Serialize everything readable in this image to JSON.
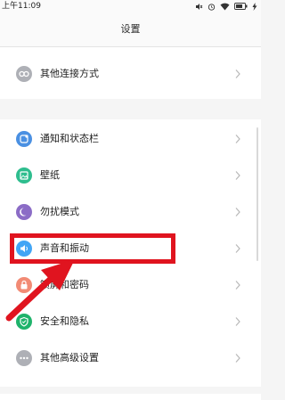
{
  "status_bar": {
    "time": "上午11:09",
    "icons": [
      "mute-icon",
      "alarm-icon",
      "wifi-icon",
      "battery-icon",
      "charging-icon"
    ]
  },
  "title_bar": {
    "title": "设置"
  },
  "settings": {
    "top_group": [
      {
        "label": "其他连接方式",
        "icon": "link-icon",
        "color": "#aeb0b6"
      }
    ],
    "main_group": [
      {
        "label": "通知和状态栏",
        "icon": "notification-icon",
        "color": "#4a90e2"
      },
      {
        "label": "壁纸",
        "icon": "wallpaper-icon",
        "color": "#2ebd8e"
      },
      {
        "label": "勿扰模式",
        "icon": "moon-icon",
        "color": "#8b6cc6"
      },
      {
        "label": "声音和振动",
        "icon": "speaker-icon",
        "color": "#42a5f5"
      },
      {
        "label": "锁屏和密码",
        "icon": "lock-icon",
        "color": "#f28b75"
      },
      {
        "label": "安全和隐私",
        "icon": "shield-icon",
        "color": "#1fb36b"
      },
      {
        "label": "其他高级设置",
        "icon": "more-icon",
        "color": "#aeb0b6"
      }
    ]
  },
  "annotation": {
    "color": "#e0141f",
    "highlight_target": "声音和振动"
  }
}
